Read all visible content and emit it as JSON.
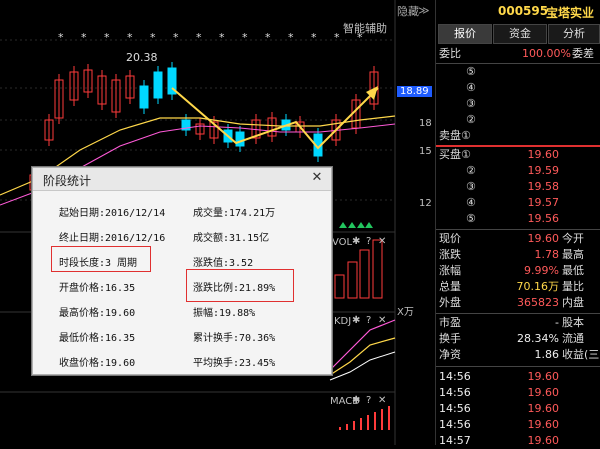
{
  "chart": {
    "smart_assist_label": "智能辅助",
    "hide_label": "隐藏",
    "scroll_arrows": "≫",
    "high_price_label": "20.38",
    "current_price_tag": "18.89",
    "price_axis": [
      "18",
      "15",
      "12"
    ],
    "vol_label": "VOL",
    "vol_unit": "X万",
    "kdj_label": "KDJ",
    "macd_label": "MACD",
    "gear_icon": "gear-icon",
    "help_icon": "help-icon"
  },
  "stock": {
    "code": "000595",
    "name": "宝塔实业"
  },
  "tabs": [
    "报价",
    "资金",
    "分析"
  ],
  "order_book": {
    "wei_bi_label": "委比",
    "wei_bi_value": "100.00%",
    "wei_cha_label": "委差",
    "sell_labels": [
      "⑤",
      "④",
      "③",
      "②",
      "卖盘①"
    ],
    "buy_rows": [
      {
        "label": "买盘①",
        "price": "19.60"
      },
      {
        "label": "②",
        "price": "19.59"
      },
      {
        "label": "③",
        "price": "19.58"
      },
      {
        "label": "④",
        "price": "19.57"
      },
      {
        "label": "⑤",
        "price": "19.56"
      }
    ]
  },
  "quote": {
    "rows": [
      {
        "label": "现价",
        "value": "19.60",
        "suffix": "今开"
      },
      {
        "label": "涨跌",
        "value": "1.78",
        "suffix": "最高"
      },
      {
        "label": "涨幅",
        "value": "9.99%",
        "suffix": "最低"
      },
      {
        "label": "总量",
        "value": "70.16万",
        "suffix": "量比"
      },
      {
        "label": "外盘",
        "value": "365823",
        "suffix": "内盘"
      },
      {
        "label": "市盈",
        "value": "-",
        "suffix": "股本"
      },
      {
        "label": "换手",
        "value": "28.34%",
        "suffix": "流通"
      },
      {
        "label": "净资",
        "value": "1.86",
        "suffix": "收益(三"
      }
    ]
  },
  "ticks": [
    {
      "time": "14:56",
      "price": "19.60"
    },
    {
      "time": "14:56",
      "price": "19.60"
    },
    {
      "time": "14:56",
      "price": "19.60"
    },
    {
      "time": "14:56",
      "price": "19.60"
    },
    {
      "time": "14:57",
      "price": "19.60"
    }
  ],
  "dialog": {
    "title": "阶段统计",
    "close": "✕",
    "start_date": "起始日期:2016/12/14",
    "end_date": "终止日期:2016/12/16",
    "period_length": "时段长度:3 周期",
    "open_price": "开盘价格:16.35",
    "high_price": "最高价格:19.60",
    "low_price": "最低价格:16.35",
    "close_price": "收盘价格:19.60",
    "volume": "成交量:174.21万",
    "amount": "成交额:31.15亿",
    "change_value": "涨跌值:3.52",
    "change_ratio": "涨跌比例:21.89%",
    "amplitude": "振幅:19.88%",
    "cumulative_turnover": "累计换手:70.36%",
    "average_turnover": "平均换手:23.45%"
  }
}
